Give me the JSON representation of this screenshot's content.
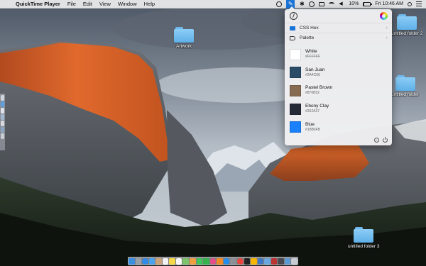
{
  "menubar": {
    "app_name": "QuickTime Player",
    "items": [
      "File",
      "Edit",
      "View",
      "Window",
      "Help"
    ],
    "battery_percent": 10,
    "battery_label": "10%",
    "clock": "Fri 10:46 AM"
  },
  "desktop": {
    "folders": [
      {
        "label": "Artwork"
      },
      {
        "label": "untitled folder 2"
      },
      {
        "label": "untitled folder"
      },
      {
        "label": "untitled folder 3"
      }
    ]
  },
  "popover": {
    "rows": [
      {
        "label": "CSS Hex",
        "icon": "hex-format-icon"
      },
      {
        "label": "Palette",
        "icon": "palette-icon"
      }
    ],
    "swatches": [
      {
        "name": "White",
        "hex": "#FFFFFF",
        "color": "#FFFFFF"
      },
      {
        "name": "San Juan",
        "hex": "#2A4C66",
        "color": "#2A4C66"
      },
      {
        "name": "Pastel Brown",
        "hex": "#876B52",
        "color": "#876B52"
      },
      {
        "name": "Ebony Clay",
        "hex": "#252A37",
        "color": "#252A37"
      },
      {
        "name": "Blue",
        "hex": "#1B80FB",
        "color": "#1B80FB"
      }
    ]
  },
  "colors": {
    "accent": "#1B75D9",
    "folder": "#6FB8EA"
  }
}
